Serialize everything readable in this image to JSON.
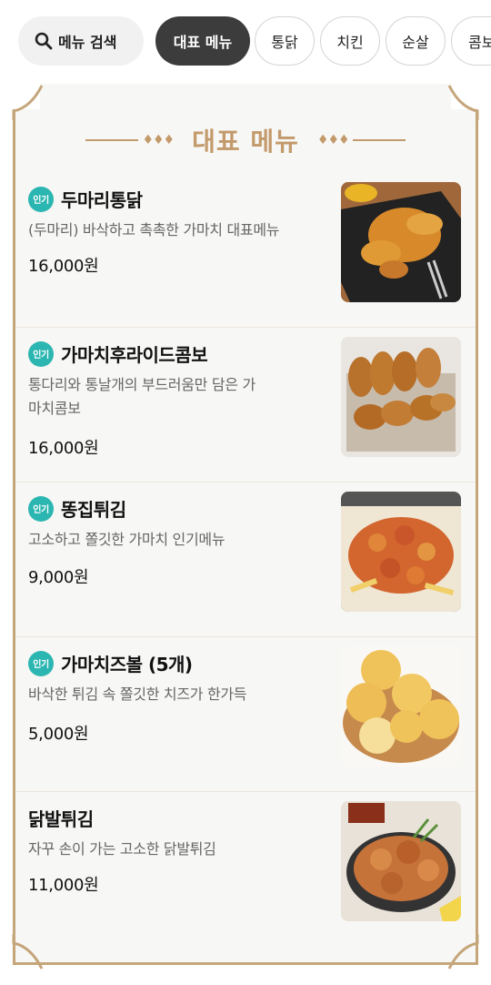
{
  "chips": {
    "search_label": "메뉴 검색",
    "active_label": "대표 메뉴",
    "items": [
      "통닭",
      "치킨",
      "순살",
      "콤보"
    ]
  },
  "section": {
    "title": "대표 메뉴",
    "deco": "♦♦♦"
  },
  "menu": [
    {
      "name": "두마리통닭",
      "badge": "인기",
      "desc": "(두마리) 바삭하고 촉촉한 가마치 대표메뉴",
      "price": "16,000원",
      "image": "roast-chicken-photo"
    },
    {
      "name": "가마치후라이드콤보",
      "badge": "인기",
      "desc": "통다리와 통날개의 부드러움만 담은 가마치콤보",
      "price": "16,000원",
      "image": "fried-combo-photo"
    },
    {
      "name": "똥집튀김",
      "badge": "인기",
      "desc": "고소하고 쫄깃한 가마치 인기메뉴",
      "price": "9,000원",
      "image": "gizzard-photo"
    },
    {
      "name": "가마치즈볼 (5개)",
      "badge": "인기",
      "desc": "바삭한 튀김 속 쫄깃한 치즈가 한가득",
      "price": "5,000원",
      "image": "cheese-ball-photo"
    },
    {
      "name": "닭발튀김",
      "badge": "",
      "desc": "자꾸 손이 가는 고소한 닭발튀김",
      "price": "11,000원",
      "image": "chicken-feet-photo"
    }
  ],
  "colors": {
    "accent": "#c39a6b",
    "badge": "#2cb6b1",
    "active_chip": "#3c3c3c"
  }
}
